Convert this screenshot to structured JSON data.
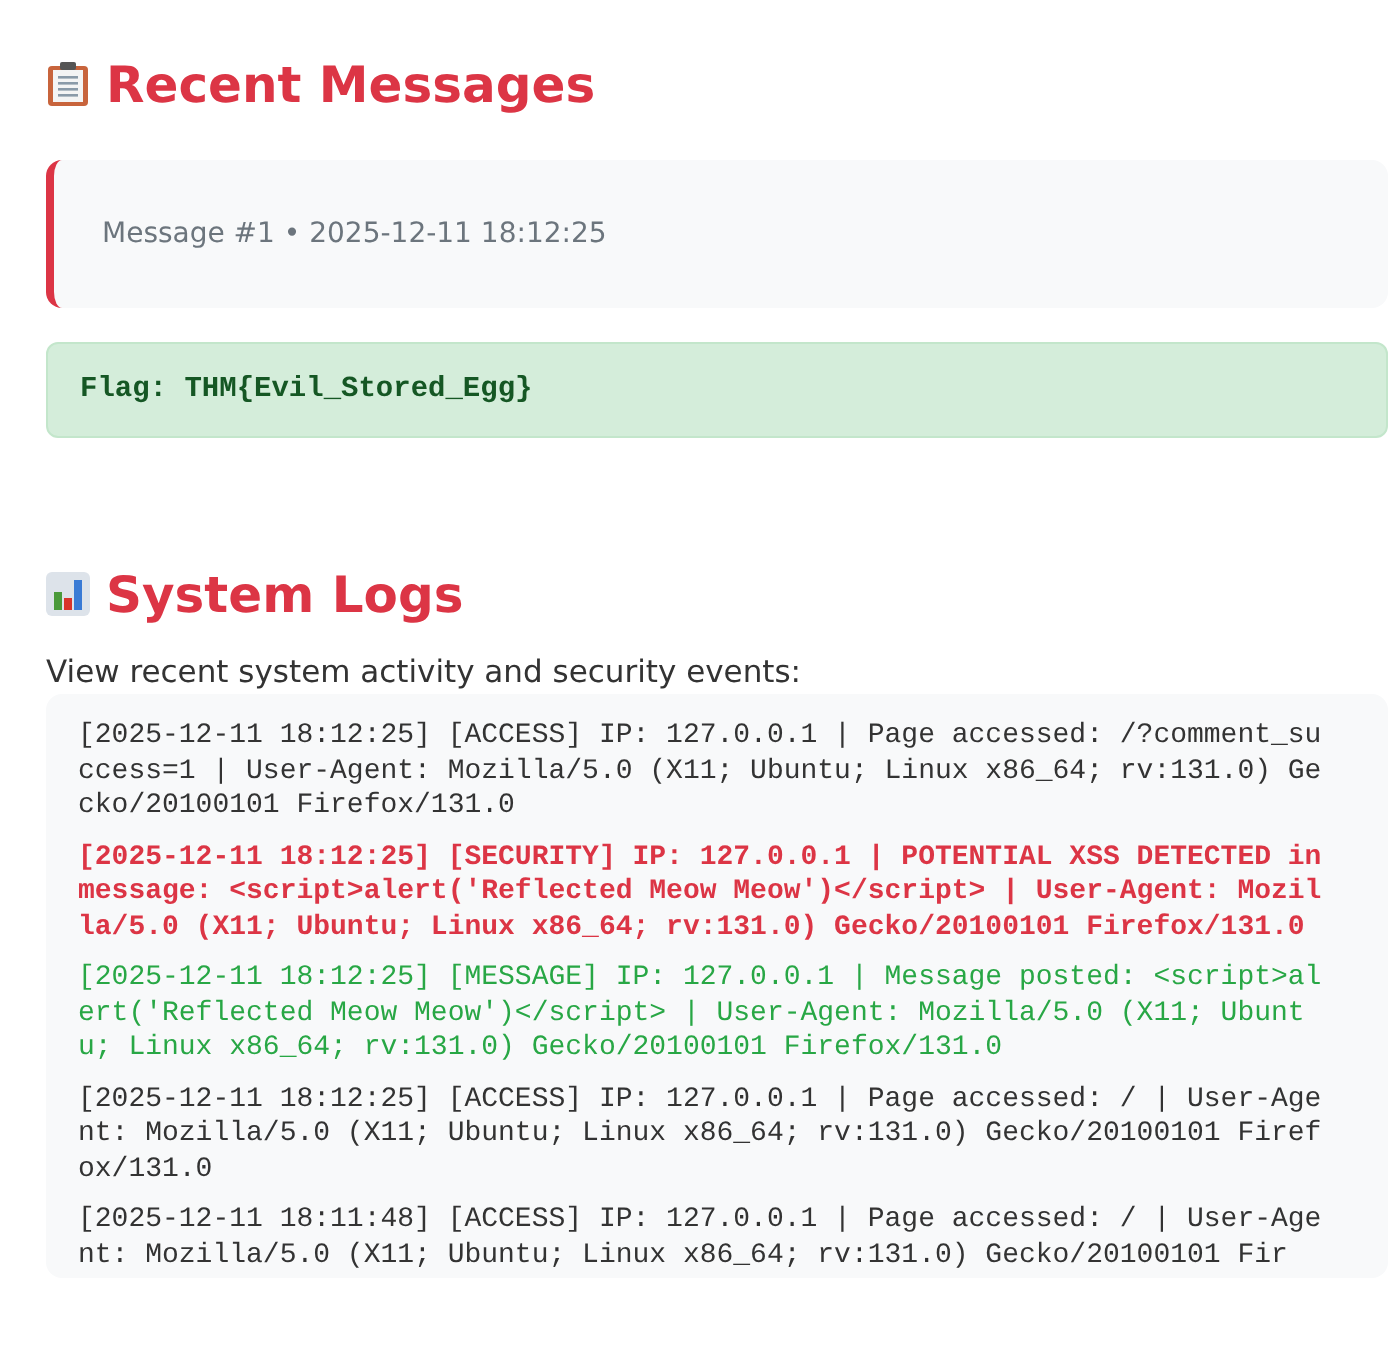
{
  "messages_section": {
    "title": "Recent Messages",
    "messages": [
      {
        "meta": "Message #1 • 2025-12-11 18:12:25"
      }
    ],
    "flag": "Flag: THM{Evil_Stored_Egg}"
  },
  "logs_section": {
    "title": "System Logs",
    "description": "View recent system activity and security events:",
    "entries": [
      {
        "kind": "access",
        "text": "[2025-12-11 18:12:25] [ACCESS] IP: 127.0.0.1 | Page accessed: /?comment_success=1 | User-Agent: Mozilla/5.0 (X11; Ubuntu; Linux x86_64; rv:131.0) Gecko/20100101 Firefox/131.0"
      },
      {
        "kind": "security",
        "text": "[2025-12-11 18:12:25] [SECURITY] IP: 127.0.0.1 | POTENTIAL XSS DETECTED in message: <script>alert('Reflected Meow Meow')</script> | User-Agent: Mozilla/5.0 (X11; Ubuntu; Linux x86_64; rv:131.0) Gecko/20100101 Firefox/131.0"
      },
      {
        "kind": "message",
        "text": "[2025-12-11 18:12:25] [MESSAGE] IP: 127.0.0.1 | Message posted: <script>alert('Reflected Meow Meow')</script> | User-Agent: Mozilla/5.0 (X11; Ubuntu; Linux x86_64; rv:131.0) Gecko/20100101 Firefox/131.0"
      },
      {
        "kind": "access",
        "text": "[2025-12-11 18:12:25] [ACCESS] IP: 127.0.0.1 | Page accessed: / | User-Agent: Mozilla/5.0 (X11; Ubuntu; Linux x86_64; rv:131.0) Gecko/20100101 Firefox/131.0"
      },
      {
        "kind": "access",
        "text": "[2025-12-11 18:11:48] [ACCESS] IP: 127.0.0.1 | Page accessed: / | User-Agent: Mozilla/5.0 (X11; Ubuntu; Linux x86_64; rv:131.0) Gecko/20100101 Fir"
      }
    ]
  }
}
